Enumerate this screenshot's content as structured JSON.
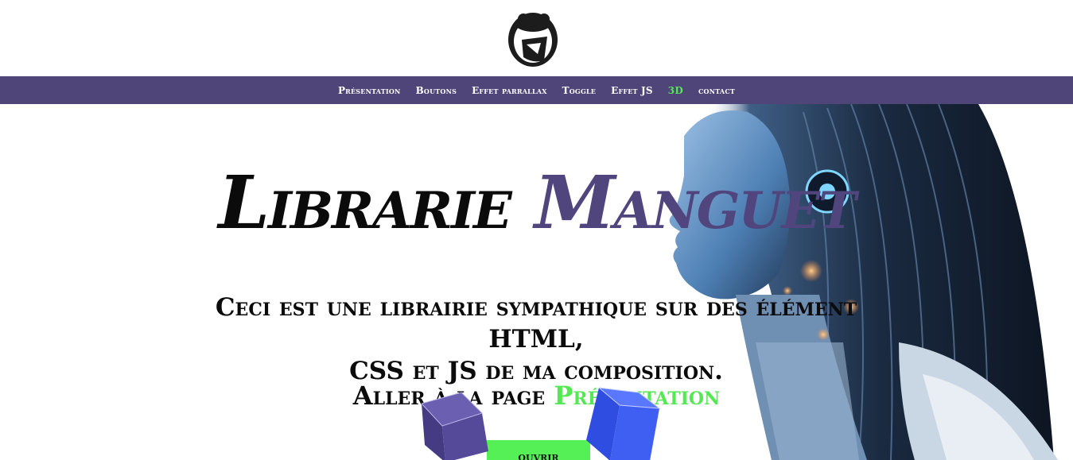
{
  "brand": {
    "logo_icon": "otter-head-icon"
  },
  "nav": {
    "items": [
      {
        "label": "Présentation"
      },
      {
        "label": "Boutons"
      },
      {
        "label": "Effet parrallax"
      },
      {
        "label": "Toggle"
      },
      {
        "label": "Effet JS"
      },
      {
        "label": "3D"
      },
      {
        "label": "contact"
      }
    ],
    "active_index": 5
  },
  "hero": {
    "title_word1": "Librarie",
    "title_word2": "Manguet",
    "subtitle_line1": "Ceci est une librairie sympathique sur des élément HTML,",
    "subtitle_line2": "CSS et JS de ma composition.",
    "goto_prefix": "Aller à la page",
    "goto_link": "Présentation",
    "button_label": "ouvrir"
  },
  "colors": {
    "accent": "#4f4579",
    "highlight": "#55e855",
    "text": "#0b0b0b"
  }
}
